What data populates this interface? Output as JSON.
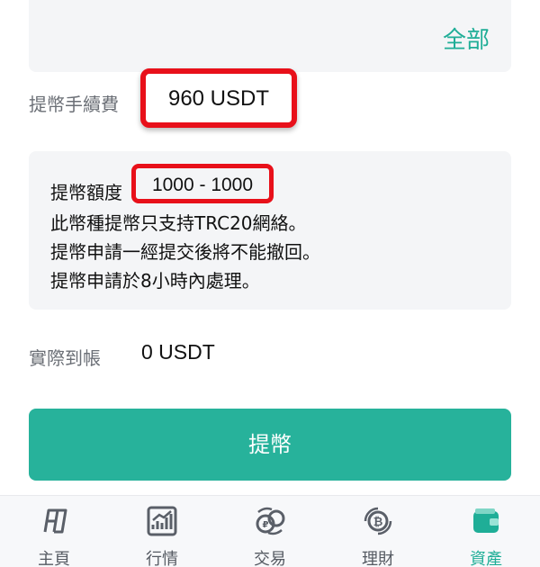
{
  "amount_box": {
    "all_label": "全部"
  },
  "fee": {
    "label": "提幣手續費",
    "value": "960 USDT"
  },
  "info": {
    "limit_label": "提幣額度",
    "limit_value": "1000 - 1000",
    "line2": "此幣種提幣只支持TRC20網絡。",
    "line3": "提幣申請一經提交後將不能撤回。",
    "line4": "提幣申請於8小時內處理。"
  },
  "received": {
    "label": "實際到帳",
    "value": "0 USDT"
  },
  "submit_label": "提幣",
  "nav": {
    "active_color": "#1fae97",
    "items": [
      {
        "label": "主頁",
        "icon": "home-logo-icon"
      },
      {
        "label": "行情",
        "icon": "chart-icon"
      },
      {
        "label": "交易",
        "icon": "exchange-icon"
      },
      {
        "label": "理財",
        "icon": "bitcoin-finance-icon"
      },
      {
        "label": "資產",
        "icon": "wallet-icon"
      }
    ]
  }
}
